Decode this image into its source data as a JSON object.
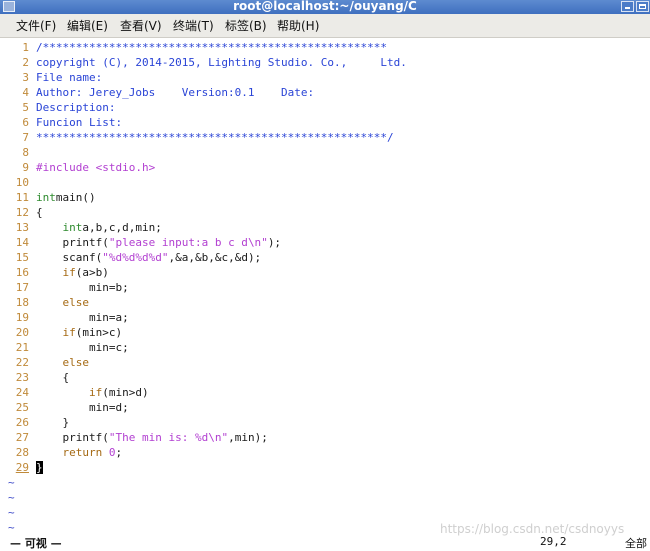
{
  "window": {
    "title": "root@localhost:~/ouyang/C"
  },
  "menu": {
    "items": [
      "文件(F)",
      "编辑(E)",
      "查看(V)",
      "终端(T)",
      "标签(B)",
      "帮助(H)"
    ]
  },
  "editor": {
    "lines": [
      {
        "n": "1",
        "parts": [
          [
            "c-comment",
            "/****************************************************"
          ]
        ]
      },
      {
        "n": "2",
        "parts": [
          [
            "c-comment",
            "copyright (C), 2014-2015, Lighting Studio. Co.,     Ltd."
          ]
        ]
      },
      {
        "n": "3",
        "parts": [
          [
            "c-comment",
            "File name:"
          ]
        ]
      },
      {
        "n": "4",
        "parts": [
          [
            "c-comment",
            "Author: Jerey_Jobs    Version:0.1    Date:"
          ]
        ]
      },
      {
        "n": "5",
        "parts": [
          [
            "c-comment",
            "Description:"
          ]
        ]
      },
      {
        "n": "6",
        "parts": [
          [
            "c-comment",
            "Funcion List:"
          ]
        ]
      },
      {
        "n": "7",
        "parts": [
          [
            "c-comment",
            "*****************************************************/"
          ]
        ]
      },
      {
        "n": "8",
        "parts": []
      },
      {
        "n": "9",
        "parts": [
          [
            "c-pre",
            "#include <stdio.h>"
          ]
        ]
      },
      {
        "n": "10",
        "parts": []
      },
      {
        "n": "11",
        "parts": [
          [
            "c-type",
            "int"
          ],
          [
            "",
            "main()"
          ]
        ]
      },
      {
        "n": "12",
        "parts": [
          [
            "",
            "{"
          ]
        ]
      },
      {
        "n": "13",
        "parts": [
          [
            "",
            "    "
          ],
          [
            "c-type",
            "int"
          ],
          [
            "",
            "a,b,c,d,min;"
          ]
        ]
      },
      {
        "n": "14",
        "parts": [
          [
            "",
            "    printf("
          ],
          [
            "c-str",
            "\"please input:a b c d"
          ],
          [
            "c-fmt",
            "\\n"
          ],
          [
            "c-str",
            "\""
          ],
          [
            "",
            ");"
          ]
        ]
      },
      {
        "n": "15",
        "parts": [
          [
            "",
            "    scanf("
          ],
          [
            "c-str",
            "\""
          ],
          [
            "c-fmt",
            "%d%d%d%d"
          ],
          [
            "c-str",
            "\""
          ],
          [
            "",
            ",&a,&b,&c,&d);"
          ]
        ]
      },
      {
        "n": "16",
        "parts": [
          [
            "",
            "    "
          ],
          [
            "c-kw",
            "if"
          ],
          [
            "",
            "(a>b)"
          ]
        ]
      },
      {
        "n": "17",
        "parts": [
          [
            "",
            "        min=b;"
          ]
        ]
      },
      {
        "n": "18",
        "parts": [
          [
            "",
            "    "
          ],
          [
            "c-kw",
            "else"
          ]
        ]
      },
      {
        "n": "19",
        "parts": [
          [
            "",
            "        min=a;"
          ]
        ]
      },
      {
        "n": "20",
        "parts": [
          [
            "",
            "    "
          ],
          [
            "c-kw",
            "if"
          ],
          [
            "",
            "(min>c)"
          ]
        ]
      },
      {
        "n": "21",
        "parts": [
          [
            "",
            "        min=c;"
          ]
        ]
      },
      {
        "n": "22",
        "parts": [
          [
            "",
            "    "
          ],
          [
            "c-kw",
            "else"
          ]
        ]
      },
      {
        "n": "23",
        "parts": [
          [
            "",
            "    {"
          ]
        ]
      },
      {
        "n": "24",
        "parts": [
          [
            "",
            "        "
          ],
          [
            "c-kw",
            "if"
          ],
          [
            "",
            "(min>d)"
          ]
        ]
      },
      {
        "n": "25",
        "parts": [
          [
            "",
            "        min=d;"
          ]
        ]
      },
      {
        "n": "26",
        "parts": [
          [
            "",
            "    }"
          ]
        ]
      },
      {
        "n": "27",
        "parts": [
          [
            "",
            "    printf("
          ],
          [
            "c-str",
            "\"The min is: "
          ],
          [
            "c-fmt",
            "%d\\n"
          ],
          [
            "c-str",
            "\""
          ],
          [
            "",
            ",min);"
          ]
        ]
      },
      {
        "n": "28",
        "parts": [
          [
            "",
            "    "
          ],
          [
            "c-kw",
            "return"
          ],
          [
            "c-num",
            " 0"
          ],
          [
            "",
            ";"
          ]
        ]
      },
      {
        "n": "29",
        "parts": [
          [
            "cursor",
            "}"
          ]
        ]
      }
    ],
    "tildes": [
      "~",
      "~",
      "~",
      "~"
    ]
  },
  "status": {
    "mode": "— 可视 —",
    "position": "29,2",
    "scroll": "全部"
  },
  "watermark": "https://blog.csdn.net/csdnoyys"
}
